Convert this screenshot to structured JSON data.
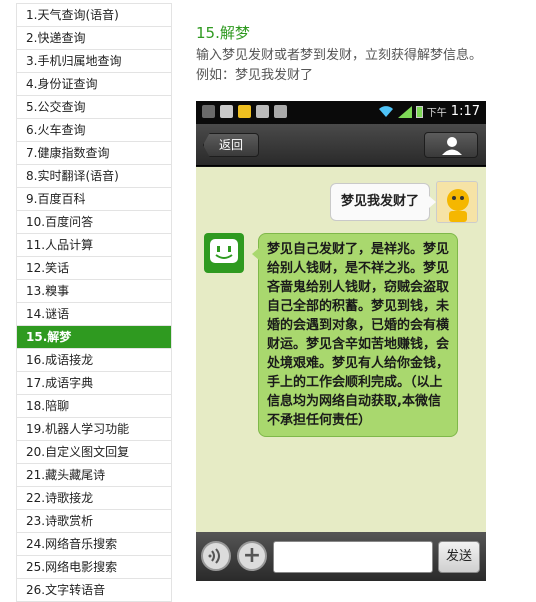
{
  "sidebar": {
    "items": [
      {
        "label": "1.天气查询(语音)"
      },
      {
        "label": "2.快递查询"
      },
      {
        "label": "3.手机归属地查询"
      },
      {
        "label": "4.身份证查询"
      },
      {
        "label": "5.公交查询"
      },
      {
        "label": "6.火车查询"
      },
      {
        "label": "7.健康指数查询"
      },
      {
        "label": "8.实时翻译(语音)"
      },
      {
        "label": "9.百度百科"
      },
      {
        "label": "10.百度问答"
      },
      {
        "label": "11.人品计算"
      },
      {
        "label": "12.笑话"
      },
      {
        "label": "13.糗事"
      },
      {
        "label": "14.谜语"
      },
      {
        "label": "15.解梦",
        "active": true
      },
      {
        "label": "16.成语接龙"
      },
      {
        "label": "17.成语字典"
      },
      {
        "label": "18.陪聊"
      },
      {
        "label": "19.机器人学习功能"
      },
      {
        "label": "20.自定义图文回复"
      },
      {
        "label": "21.藏头藏尾诗"
      },
      {
        "label": "22.诗歌接龙"
      },
      {
        "label": "23.诗歌赏析"
      },
      {
        "label": "24.网络音乐搜索"
      },
      {
        "label": "25.网络电影搜索"
      },
      {
        "label": "26.文字转语音"
      }
    ]
  },
  "main": {
    "title": "15.解梦",
    "description_line1": "输入梦见发财或者梦到发财，立刻获得解梦信息。",
    "description_line2": "例如：梦见我发财了"
  },
  "phone": {
    "status_pm": "下午",
    "status_time": "1:17",
    "back_label": "返回",
    "user_message": "梦见我发财了",
    "bot_reply": "梦见自己发财了，是祥兆。梦见给别人钱财，是不祥之兆。梦见吝啬鬼给别人钱财，窃贼会盗取自己全部的积蓄。梦见到钱，未婚的会遇到对象，已婚的会有横财运。梦见含辛如苦地赚钱，会处境艰难。梦见有人给你金钱，手上的工作会顺利完成。（以上信息均为网络自动获取,本微信不承担任何责任）",
    "send_label": "发送"
  },
  "colors": {
    "accent": "#2f9a20",
    "chat_bg": "#e6ebc5",
    "bot_bubble": "#a9d86e"
  }
}
